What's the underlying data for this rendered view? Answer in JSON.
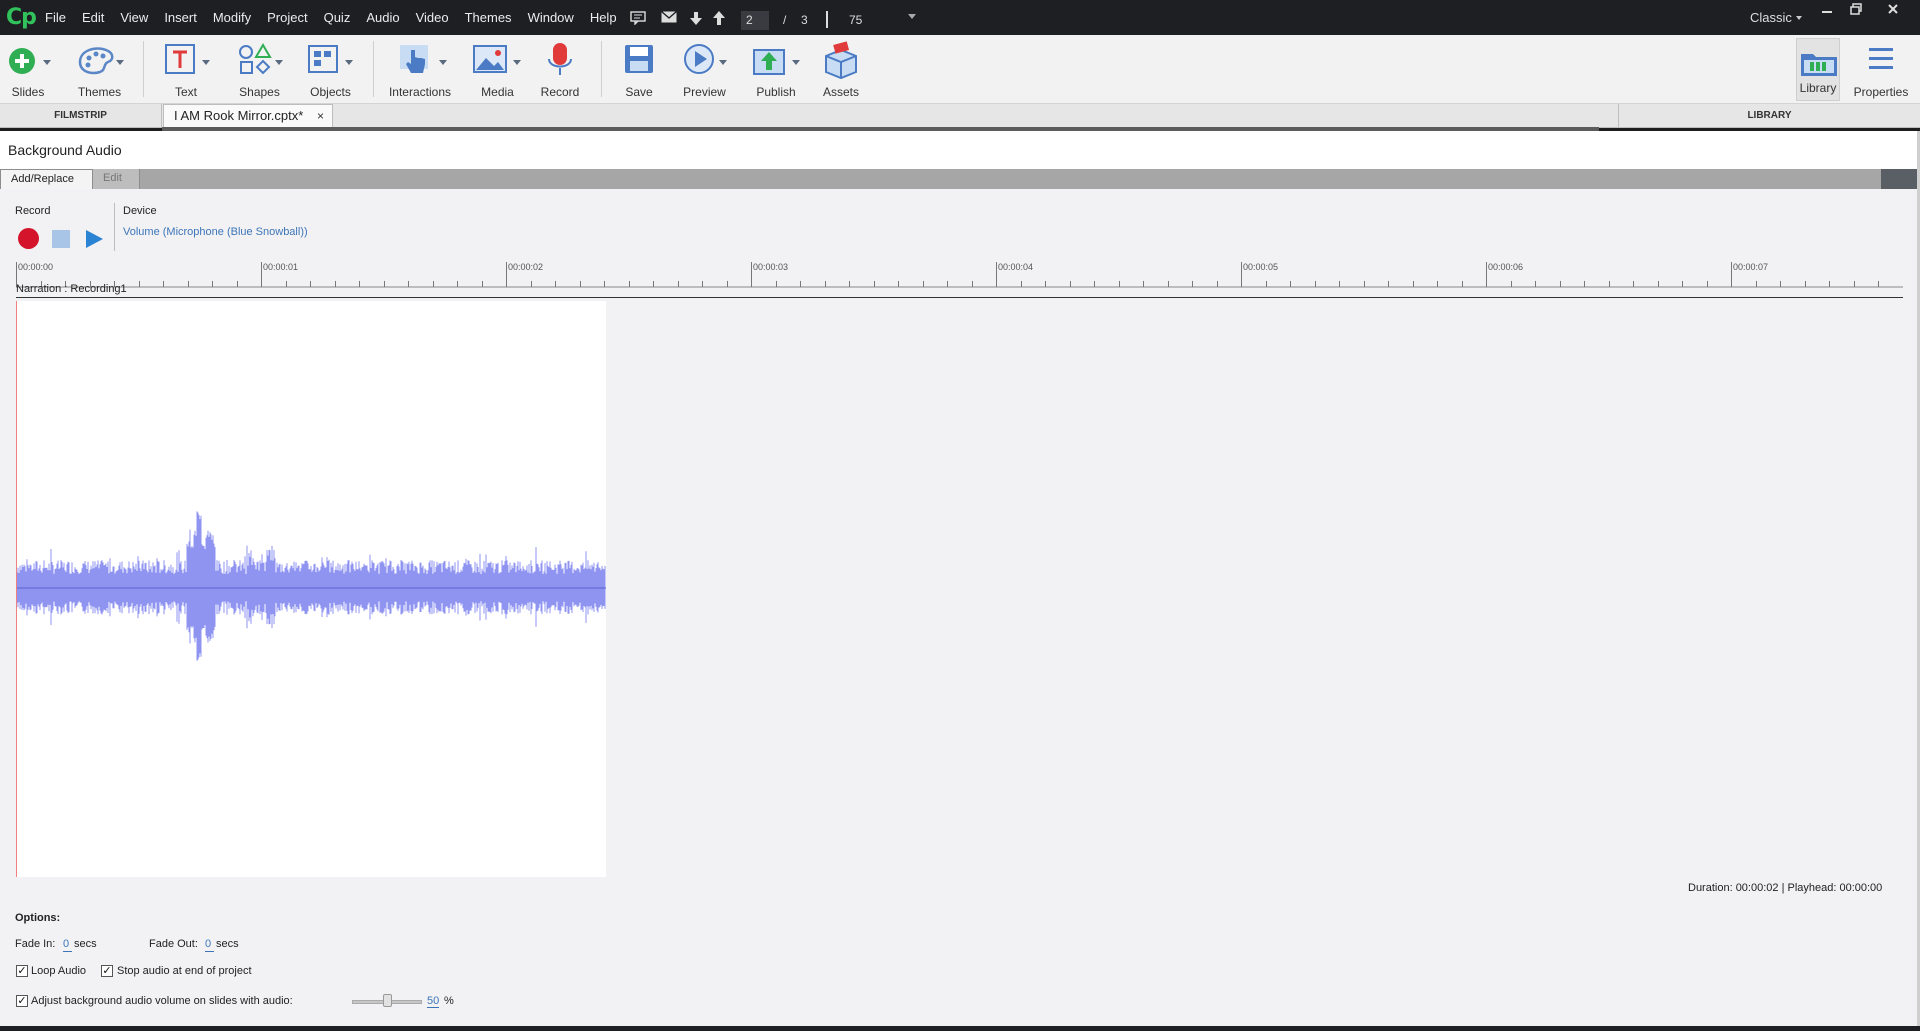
{
  "app": {
    "logo": "Cp",
    "menu": [
      "File",
      "Edit",
      "View",
      "Insert",
      "Modify",
      "Project",
      "Quiz",
      "Audio",
      "Video",
      "Themes",
      "Window",
      "Help"
    ],
    "slide_current": "2",
    "slide_separator": "/",
    "slide_total": "3",
    "zoom": "75",
    "workspace": "Classic"
  },
  "toolbar": {
    "slides": "Slides",
    "themes": "Themes",
    "text": "Text",
    "shapes": "Shapes",
    "objects": "Objects",
    "interactions": "Interactions",
    "media": "Media",
    "record": "Record",
    "save": "Save",
    "preview": "Preview",
    "publish": "Publish",
    "assets": "Assets",
    "library": "Library",
    "properties": "Properties"
  },
  "panels": {
    "filmstrip": "FILMSTRIP",
    "doc_tab": "I AM Rook Mirror.cptx*",
    "doc_tab_close": "×",
    "library": "LIBRARY"
  },
  "dialog": {
    "title": "Background Audio",
    "tab_add": "Add/Replace",
    "tab_edit": "Edit",
    "record_label": "Record",
    "device_label": "Device",
    "device_value": "Volume (Microphone (Blue Snowball))",
    "ruler_ticks": [
      "00:00:00",
      "00:00:01",
      "00:00:02",
      "00:00:03",
      "00:00:04",
      "00:00:05",
      "00:00:06",
      "00:00:07"
    ],
    "track_label": "Narration : Recording1",
    "duration_info": "Duration:  00:00:02  |  Playhead:  00:00:00",
    "options_title": "Options:",
    "fade_in_label": "Fade In:",
    "fade_in_value": "0",
    "fade_in_unit": "secs",
    "fade_out_label": "Fade Out:",
    "fade_out_value": "0",
    "fade_out_unit": "secs",
    "loop_audio": "Loop Audio",
    "stop_audio": "Stop audio at end of project",
    "adjust_volume": "Adjust background audio volume on slides with audio:",
    "volume_value": "50",
    "volume_unit": "%",
    "volume_fraction": 0.5,
    "checkmark": "✓"
  },
  "colors": {
    "waveform": "#8f94f0",
    "record": "#d3142a",
    "play": "#2b83d4",
    "link": "#3d75b8"
  }
}
